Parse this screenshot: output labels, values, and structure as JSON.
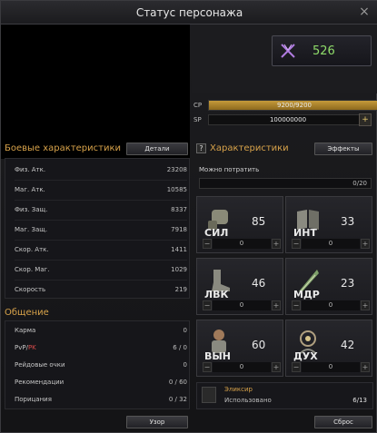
{
  "window": {
    "title": "Статус персонажа"
  },
  "pvp": {
    "value": "526"
  },
  "bars": {
    "cp": {
      "label": "CP",
      "text": "9200/9200",
      "fill": 1.0
    },
    "sp": {
      "label": "SP",
      "text": "100000000"
    }
  },
  "combat": {
    "title": "Боевые характеристики",
    "details_button": "Детали",
    "rows": [
      {
        "label": "Физ. Атк.",
        "value": "23208"
      },
      {
        "label": "Маг. Атк.",
        "value": "10585"
      },
      {
        "label": "Физ. Защ.",
        "value": "8337"
      },
      {
        "label": "Маг. Защ.",
        "value": "7918"
      },
      {
        "label": "Скор. Атк.",
        "value": "1411"
      },
      {
        "label": "Скор. Маг.",
        "value": "1029"
      },
      {
        "label": "Скорость",
        "value": "219"
      }
    ]
  },
  "social": {
    "title": "Общение",
    "rows": [
      {
        "label": "Карма",
        "value": "0"
      },
      {
        "label_pvp": "PvP/",
        "label_pk": "PK",
        "value": "6 / 0"
      },
      {
        "label": "Рейдовые очки",
        "value": "0"
      },
      {
        "label": "Рекомендации",
        "value": "0 / 60"
      },
      {
        "label": "Порицания",
        "value": "0 / 32"
      }
    ],
    "bottom_button": "Узор"
  },
  "attributes": {
    "title": "Характеристики",
    "help": "?",
    "effects_button": "Эффекты",
    "spend_label": "Можно потратить",
    "spend_value": "0/20",
    "stats": [
      {
        "name": "СИЛ",
        "value": "85",
        "counter": "0",
        "icon": "fist-icon"
      },
      {
        "name": "ИНТ",
        "value": "33",
        "counter": "0",
        "icon": "book-icon"
      },
      {
        "name": "ЛВК",
        "value": "46",
        "counter": "0",
        "icon": "boot-icon"
      },
      {
        "name": "МДР",
        "value": "23",
        "counter": "0",
        "icon": "feather-icon"
      },
      {
        "name": "ВЫН",
        "value": "60",
        "counter": "0",
        "icon": "armor-icon"
      },
      {
        "name": "ДУХ",
        "value": "42",
        "counter": "0",
        "icon": "spirit-icon"
      }
    ],
    "elixir": {
      "title": "Эликсир",
      "used_label": "Использовано",
      "used_value": "6/13"
    },
    "reset_button": "Сброс"
  },
  "colors": {
    "accent": "#d7a24a",
    "pvp_value": "#8fdc6a",
    "pk": "#d64a4a"
  }
}
